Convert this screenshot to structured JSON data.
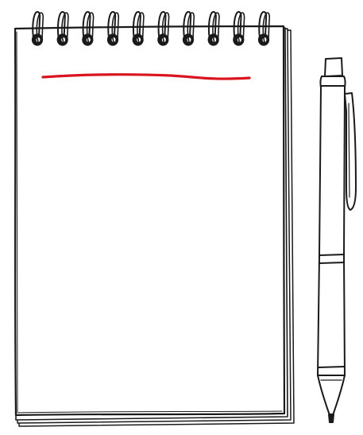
{
  "colors": {
    "background": "#ffffff",
    "ink": "#1a1a1a",
    "paper": "#ffffff",
    "headline_underline": "#d9141e"
  },
  "illustration": {
    "notepad": {
      "binding": "spiral",
      "spiral_ring_count": 10,
      "page_text": ""
    },
    "pen": {
      "type": "ballpoint-click-pen",
      "has_clip": true
    }
  }
}
